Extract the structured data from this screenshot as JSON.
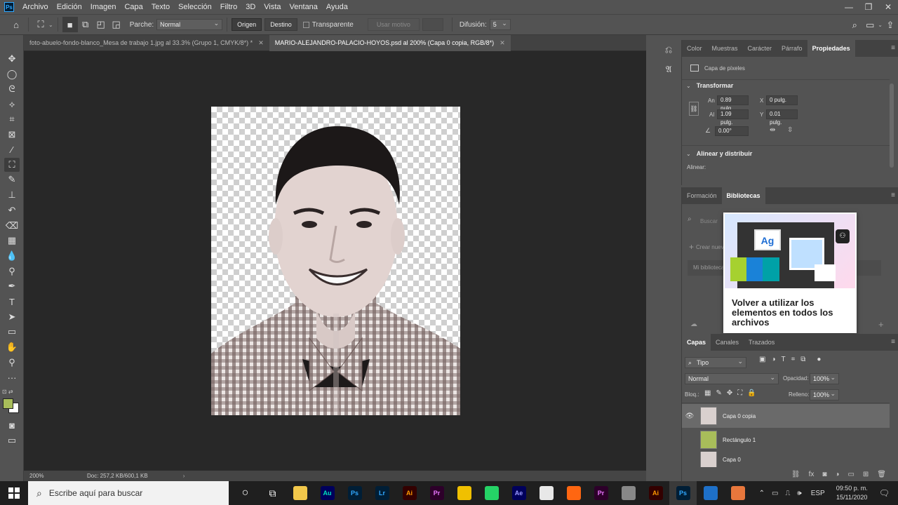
{
  "app": {
    "logo": "Ps"
  },
  "menu": [
    "Archivo",
    "Edición",
    "Imagen",
    "Capa",
    "Texto",
    "Selección",
    "Filtro",
    "3D",
    "Vista",
    "Ventana",
    "Ayuda"
  ],
  "window_controls": {
    "minimize": "—",
    "restore": "❐",
    "close": "✕"
  },
  "options_bar": {
    "patch_label": "Parche:",
    "patch_mode": "Normal",
    "origin_button": "Origen",
    "destination_button": "Destino",
    "transparent_label": "Transparente",
    "use_pattern_button": "Usar motivo",
    "diffusion_label": "Difusión:",
    "diffusion_value": "5"
  },
  "doc_tabs": [
    {
      "label": "foto-abuelo-fondo-blanco_Mesa de trabajo 1.jpg al 33.3% (Grupo 1, CMYK/8*) *",
      "active": false
    },
    {
      "label": "MARIO-ALEJANDRO-PALACIO-HOYOS.psd al 200% (Capa 0 copia, RGB/8*)",
      "active": true
    }
  ],
  "status": {
    "zoom": "200%",
    "doc": "Doc: 257,2 KB/600,1 KB"
  },
  "properties_panel": {
    "tabs": [
      "Color",
      "Muestras",
      "Carácter",
      "Párrafo",
      "Propiedades"
    ],
    "active_tab": "Propiedades",
    "layer_type": "Capa de píxeles",
    "transform_title": "Transformar",
    "width_label": "An",
    "width_value": "0.89 pulg.",
    "height_label": "Al",
    "height_value": "1.09 pulg.",
    "x_label": "X",
    "x_value": "0 pulg.",
    "y_label": "Y",
    "y_value": "0.01 pulg.",
    "angle_value": "0.00°",
    "align_title": "Alinear y distribuir",
    "align_label": "Alinear:"
  },
  "libraries_panel": {
    "tabs": [
      "Formación",
      "Bibliotecas"
    ],
    "active_tab": "Bibliotecas",
    "search_placeholder": "Buscar",
    "create_new": "Crear nueva",
    "my_library": "Mi biblioteca",
    "popup_text": "Volver a utilizar los elementos en todos los archivos",
    "popup_tile_text": "Ag"
  },
  "layers_panel": {
    "tabs": [
      "Capas",
      "Canales",
      "Trazados"
    ],
    "active_tab": "Capas",
    "filter": "Tipo",
    "blend_mode": "Normal",
    "opacity_label": "Opacidad:",
    "opacity_value": "100%",
    "lock_label": "Bloq.:",
    "fill_label": "Relleno:",
    "fill_value": "100%",
    "layers": [
      {
        "name": "Capa 0 copia",
        "visible": true,
        "selected": true
      },
      {
        "name": "Rectángulo 1",
        "visible": false,
        "selected": false
      },
      {
        "name": "Capa 0",
        "visible": false,
        "selected": false
      }
    ]
  },
  "taskbar": {
    "search_placeholder": "Escribe aquí para buscar",
    "apps": [
      {
        "label": "Au",
        "bg": "#00005b",
        "fg": "#00e4bb"
      },
      {
        "label": "Ps",
        "bg": "#001e36",
        "fg": "#31a8ff"
      },
      {
        "label": "Lr",
        "bg": "#001e36",
        "fg": "#31a8ff"
      },
      {
        "label": "Ai",
        "bg": "#330000",
        "fg": "#ff9a00"
      },
      {
        "label": "Pr",
        "bg": "#2d002a",
        "fg": "#ea77ff"
      },
      {
        "label": "",
        "bg": "#f0c000",
        "fg": "#000"
      },
      {
        "label": "",
        "bg": "#25d366",
        "fg": "#fff"
      },
      {
        "label": "Ae",
        "bg": "#00005b",
        "fg": "#9999ff"
      },
      {
        "label": "",
        "bg": "#e8e8e8",
        "fg": "#000"
      },
      {
        "label": "",
        "bg": "#ff6611",
        "fg": "#fff"
      },
      {
        "label": "Pr",
        "bg": "#2d002a",
        "fg": "#ea77ff"
      },
      {
        "label": "",
        "bg": "#888",
        "fg": "#fff"
      },
      {
        "label": "Ai",
        "bg": "#330000",
        "fg": "#ff9a00"
      },
      {
        "label": "Ps",
        "bg": "#001e36",
        "fg": "#31a8ff"
      },
      {
        "label": "",
        "bg": "#1e70c8",
        "fg": "#fff"
      },
      {
        "label": "",
        "bg": "#e8773c",
        "fg": "#fff"
      }
    ],
    "language": "ESP",
    "time": "09:50 p. m.",
    "date": "15/11/2020"
  }
}
